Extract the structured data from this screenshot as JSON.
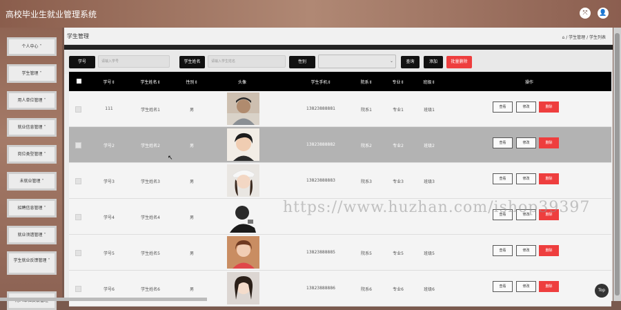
{
  "app": {
    "title": "高校毕业生就业管理系统"
  },
  "header_icons": {
    "left": "⤧",
    "right": "👤"
  },
  "sidebar": {
    "items": [
      {
        "label": "个人中心 ˅"
      },
      {
        "label": "学生管理 ˅"
      },
      {
        "label": "用人单位管理 ˅"
      },
      {
        "label": "就业信息管理 ˅"
      },
      {
        "label": "岗位类型管理 ˅"
      },
      {
        "label": "未就业管理 ˅"
      },
      {
        "label": "招聘信息管理 ˅"
      },
      {
        "label": "就业须遗管理 ˅"
      },
      {
        "label": "学生就业反馈管理 ˅"
      },
      {
        "label": "用人单位反馈管理"
      }
    ]
  },
  "panel": {
    "title": "学生管理",
    "breadcrumb": "⌂ / 学生管理 / 学生列表"
  },
  "filters": {
    "student_no_label": "学号",
    "student_no_placeholder": "请输入学号",
    "student_name_label": "学生姓名",
    "student_name_placeholder": "请输入学生姓名",
    "gender_label": "性别",
    "gender_value": "⌄"
  },
  "actions": {
    "search": "查询",
    "add": "添加",
    "batch_delete": "批量删除"
  },
  "table": {
    "headers": [
      "学号⇕",
      "学生姓名⇕",
      "性别⇕",
      "头像",
      "学生手机⇕",
      "院系⇕",
      "专业⇕",
      "班级⇕",
      "操作"
    ],
    "rows": [
      {
        "no": "111",
        "name": "学生姓名1",
        "gender": "男",
        "phone": "13823888881",
        "dept": "院系1",
        "major": "专业1",
        "cls": "班级1"
      },
      {
        "no": "学号2",
        "name": "学生姓名2",
        "gender": "男",
        "phone": "13823888882",
        "dept": "院系2",
        "major": "专业2",
        "cls": "班级2"
      },
      {
        "no": "学号3",
        "name": "学生姓名3",
        "gender": "男",
        "phone": "13823888883",
        "dept": "院系3",
        "major": "专业3",
        "cls": "班级3"
      },
      {
        "no": "学号4",
        "name": "学生姓名4",
        "gender": "男",
        "phone": "",
        "dept": "",
        "major": "",
        "cls": ""
      },
      {
        "no": "学号5",
        "name": "学生姓名5",
        "gender": "男",
        "phone": "13823888885",
        "dept": "院系5",
        "major": "专业5",
        "cls": "班级5"
      },
      {
        "no": "学号6",
        "name": "学生姓名6",
        "gender": "男",
        "phone": "13823888886",
        "dept": "院系6",
        "major": "专业6",
        "cls": "班级6"
      }
    ],
    "row_actions": {
      "view": "查看",
      "edit": "修改",
      "delete": "删除"
    }
  },
  "watermark": "https://www.huzhan.com/ishop39397",
  "back_to_top": "Top"
}
